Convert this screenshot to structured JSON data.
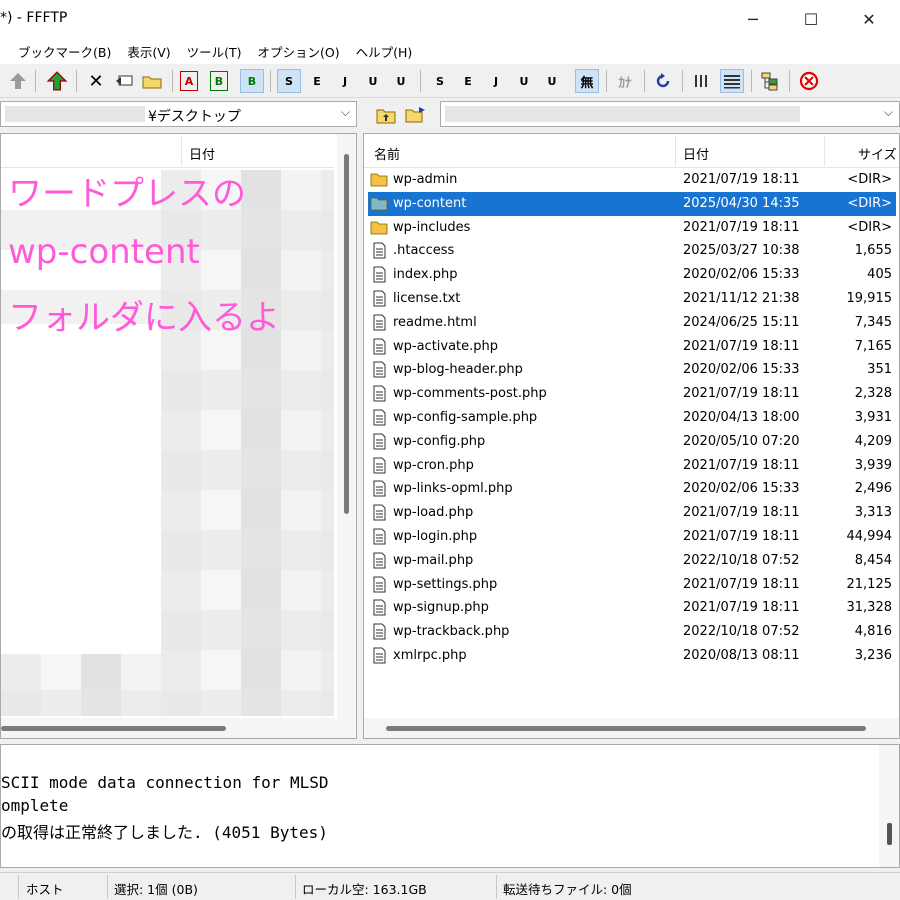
{
  "window": {
    "title": "*) - FFFTP",
    "minimize": "─",
    "maximize": "☐",
    "close": "✕"
  },
  "menu": [
    "ブックマーク(B)",
    "表示(V)",
    "ツール(T)",
    "オプション(O)",
    "ヘルプ(H)"
  ],
  "toolbar": {
    "disconnect_icon": "✕",
    "mode_labels": {
      "ascii": "A",
      "binary": "B",
      "auto": "B"
    },
    "code_labels": [
      "S",
      "E",
      "J",
      "U",
      "U",
      "S",
      "E",
      "J",
      "U",
      "U",
      "無",
      "ｶﾅ"
    ],
    "kana_label": "ｶﾅ",
    "none_label": "無"
  },
  "left_pane": {
    "path": "¥デスクトップ",
    "columns": {
      "date": "日付"
    }
  },
  "annotation": {
    "line1": "ワードプレスの",
    "line2": "wp-content",
    "line3": "フォルダに入るよ",
    "color": "#ff5ad8"
  },
  "right_pane": {
    "columns": {
      "name": "名前",
      "date": "日付",
      "size": "サイズ"
    },
    "rows": [
      {
        "type": "folder",
        "name": "wp-admin",
        "date": "2021/07/19 18:11",
        "size": "<DIR>",
        "selected": false
      },
      {
        "type": "folder",
        "name": "wp-content",
        "date": "2025/04/30 14:35",
        "size": "<DIR>",
        "selected": true
      },
      {
        "type": "folder",
        "name": "wp-includes",
        "date": "2021/07/19 18:11",
        "size": "<DIR>",
        "selected": false
      },
      {
        "type": "file",
        "name": ".htaccess",
        "date": "2025/03/27 10:38",
        "size": "1,655",
        "selected": false
      },
      {
        "type": "file",
        "name": "index.php",
        "date": "2020/02/06 15:33",
        "size": "405",
        "selected": false
      },
      {
        "type": "file",
        "name": "license.txt",
        "date": "2021/11/12 21:38",
        "size": "19,915",
        "selected": false
      },
      {
        "type": "file",
        "name": "readme.html",
        "date": "2024/06/25 15:11",
        "size": "7,345",
        "selected": false
      },
      {
        "type": "file",
        "name": "wp-activate.php",
        "date": "2021/07/19 18:11",
        "size": "7,165",
        "selected": false
      },
      {
        "type": "file",
        "name": "wp-blog-header.php",
        "date": "2020/02/06 15:33",
        "size": "351",
        "selected": false
      },
      {
        "type": "file",
        "name": "wp-comments-post.php",
        "date": "2021/07/19 18:11",
        "size": "2,328",
        "selected": false
      },
      {
        "type": "file",
        "name": "wp-config-sample.php",
        "date": "2020/04/13 18:00",
        "size": "3,931",
        "selected": false
      },
      {
        "type": "file",
        "name": "wp-config.php",
        "date": "2020/05/10 07:20",
        "size": "4,209",
        "selected": false
      },
      {
        "type": "file",
        "name": "wp-cron.php",
        "date": "2021/07/19 18:11",
        "size": "3,939",
        "selected": false
      },
      {
        "type": "file",
        "name": "wp-links-opml.php",
        "date": "2020/02/06 15:33",
        "size": "2,496",
        "selected": false
      },
      {
        "type": "file",
        "name": "wp-load.php",
        "date": "2021/07/19 18:11",
        "size": "3,313",
        "selected": false
      },
      {
        "type": "file",
        "name": "wp-login.php",
        "date": "2021/07/19 18:11",
        "size": "44,994",
        "selected": false
      },
      {
        "type": "file",
        "name": "wp-mail.php",
        "date": "2022/10/18 07:52",
        "size": "8,454",
        "selected": false
      },
      {
        "type": "file",
        "name": "wp-settings.php",
        "date": "2021/07/19 18:11",
        "size": "21,125",
        "selected": false
      },
      {
        "type": "file",
        "name": "wp-signup.php",
        "date": "2021/07/19 18:11",
        "size": "31,328",
        "selected": false
      },
      {
        "type": "file",
        "name": "wp-trackback.php",
        "date": "2022/10/18 07:52",
        "size": "4,816",
        "selected": false
      },
      {
        "type": "file",
        "name": "xmlrpc.php",
        "date": "2020/08/13 08:11",
        "size": "3,236",
        "selected": false
      }
    ]
  },
  "log": [
    "SCII mode data connection for MLSD",
    "omplete",
    "の取得は正常終了しました. (4051 Bytes)"
  ],
  "status": {
    "host": "ホスト",
    "selection": "選択: 1個 (0B)",
    "local_free": "ローカル空: 163.1GB",
    "queue": "転送待ちファイル: 0個"
  },
  "colors": {
    "selection": "#1874d2",
    "folder": "#f5c242"
  }
}
